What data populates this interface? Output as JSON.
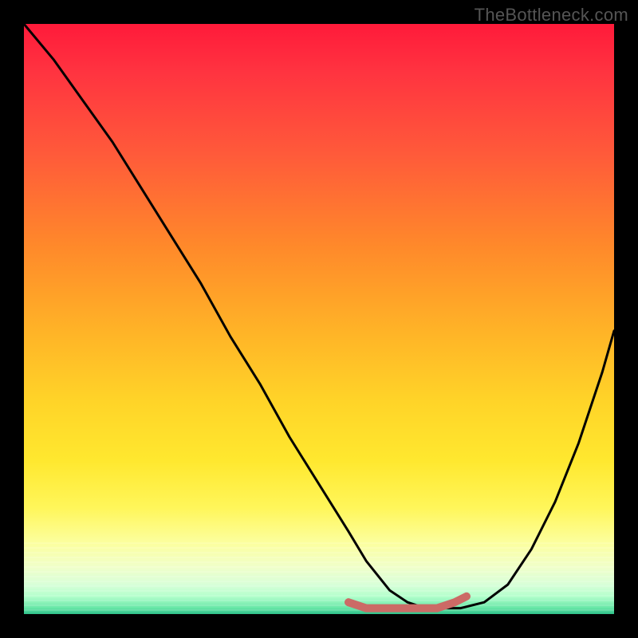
{
  "attribution": "TheBottleneck.com",
  "chart_data": {
    "type": "line",
    "title": "",
    "xlabel": "",
    "ylabel": "",
    "xlim": [
      0,
      100
    ],
    "ylim": [
      0,
      100
    ],
    "series": [
      {
        "name": "bottleneck-curve",
        "x": [
          0,
          5,
          10,
          15,
          20,
          25,
          30,
          35,
          40,
          45,
          50,
          55,
          58,
          62,
          65,
          68,
          70,
          74,
          78,
          82,
          86,
          90,
          94,
          98,
          100
        ],
        "values": [
          100,
          94,
          87,
          80,
          72,
          64,
          56,
          47,
          39,
          30,
          22,
          14,
          9,
          4,
          2,
          1,
          1,
          1,
          2,
          5,
          11,
          19,
          29,
          41,
          48
        ],
        "color": "#000000",
        "stroke_width": 3
      },
      {
        "name": "optimal-marker",
        "x": [
          55,
          58,
          61,
          64,
          67,
          70,
          73,
          75
        ],
        "values": [
          2,
          1,
          1,
          1,
          1,
          1,
          2,
          3
        ],
        "color": "#cc6a66",
        "stroke_width": 10
      }
    ],
    "background_gradient": {
      "direction": "vertical",
      "stops": [
        {
          "pos": 0.0,
          "color": "#ff1a3a"
        },
        {
          "pos": 0.22,
          "color": "#ff5a3a"
        },
        {
          "pos": 0.52,
          "color": "#ffb327"
        },
        {
          "pos": 0.74,
          "color": "#ffe82f"
        },
        {
          "pos": 0.95,
          "color": "#d8ffd8"
        },
        {
          "pos": 1.0,
          "color": "#2dbf89"
        }
      ]
    }
  }
}
